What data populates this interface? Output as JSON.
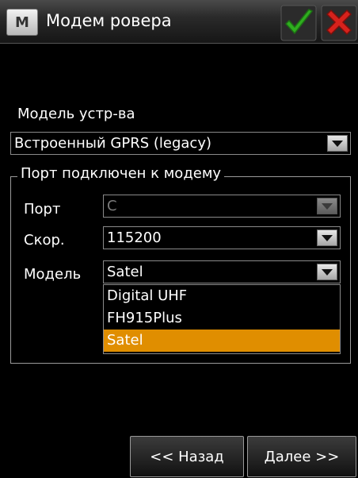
{
  "window": {
    "title": "Модем ровера",
    "menu_glyph": "M",
    "ok_icon": "checkmark-icon",
    "cancel_icon": "close-icon",
    "colors": {
      "ok": "#2fae1f",
      "cancel": "#d6221c",
      "highlight": "#e08e00"
    }
  },
  "device": {
    "label": "Модель устр-ва",
    "value": "Встроенный GPRS (legacy)"
  },
  "port_group": {
    "title": "Порт подключен к модему",
    "port": {
      "label": "Порт",
      "value": "C",
      "enabled": false
    },
    "speed": {
      "label": "Скор.",
      "value": "115200"
    },
    "model": {
      "label": "Модель",
      "value": "Satel",
      "options": [
        "Digital UHF",
        "FH915Plus",
        "Satel"
      ],
      "selected": "Satel"
    }
  },
  "footer": {
    "back_label": "<< Назад",
    "next_label": "Далее >>"
  }
}
